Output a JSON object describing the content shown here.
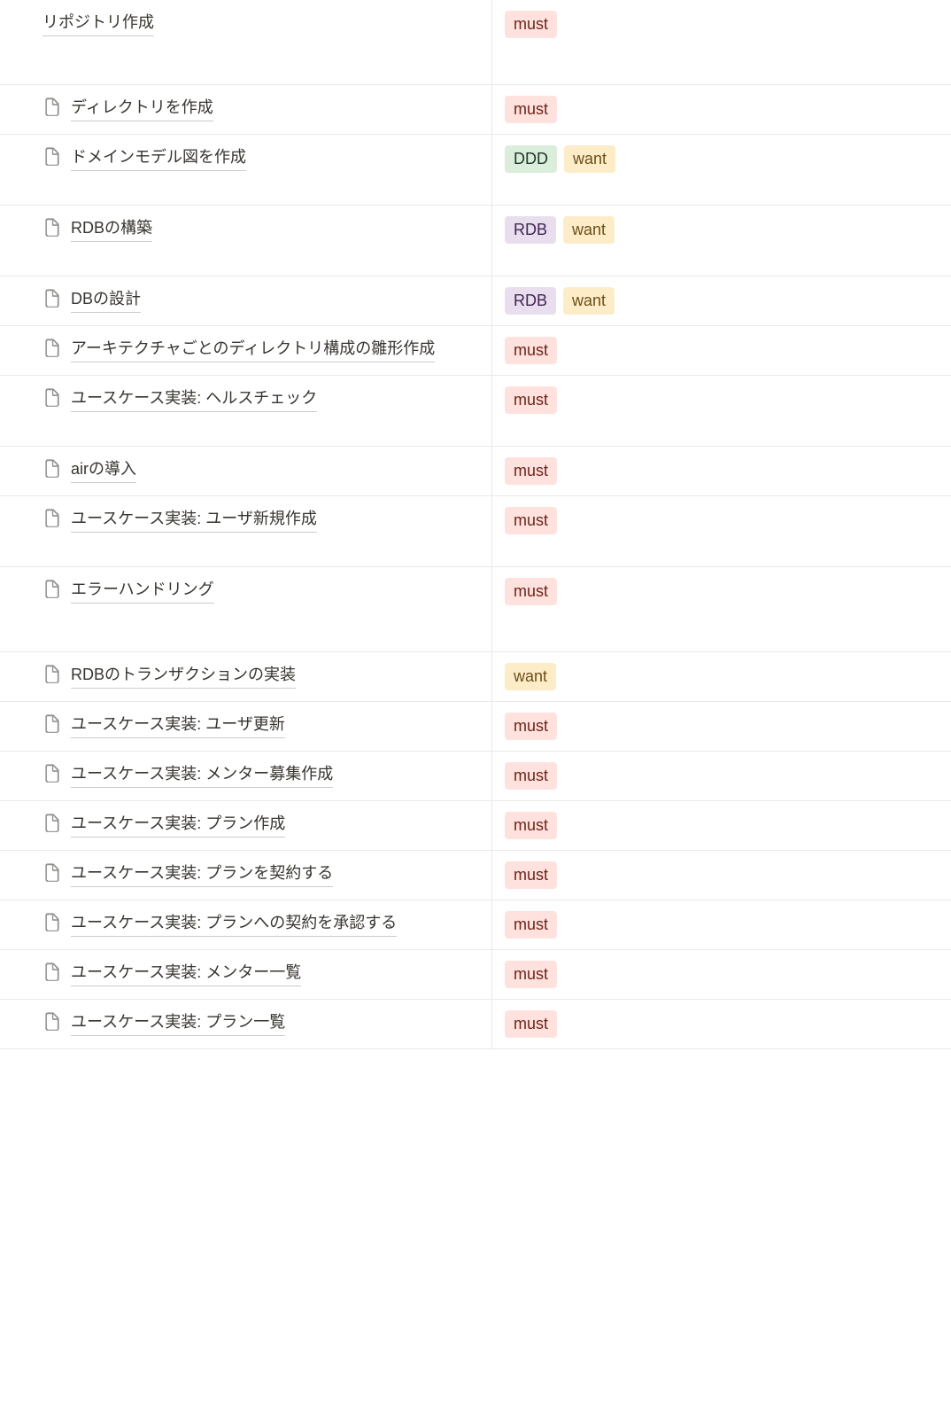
{
  "tags": {
    "must": "must",
    "want": "want",
    "ddd": "DDD",
    "rdb": "RDB"
  },
  "rows": [
    {
      "title": "リポジトリ作成",
      "icon": false,
      "tags": [
        "must"
      ],
      "height": "tall"
    },
    {
      "title": "ディレクトリを作成",
      "icon": true,
      "tags": [
        "must"
      ],
      "height": ""
    },
    {
      "title": "ドメインモデル図を作成",
      "icon": true,
      "tags": [
        "ddd",
        "want"
      ],
      "height": "med"
    },
    {
      "title": "RDBの構築",
      "icon": true,
      "tags": [
        "rdb",
        "want"
      ],
      "height": "med"
    },
    {
      "title": "DBの設計",
      "icon": true,
      "tags": [
        "rdb",
        "want"
      ],
      "height": ""
    },
    {
      "title": "アーキテクチャごとのディレクトリ構成の雛形作成",
      "icon": true,
      "tags": [
        "must"
      ],
      "height": ""
    },
    {
      "title": "ユースケース実装: ヘルスチェック",
      "icon": true,
      "tags": [
        "must"
      ],
      "height": "med"
    },
    {
      "title": "airの導入",
      "icon": true,
      "tags": [
        "must"
      ],
      "height": ""
    },
    {
      "title": "ユースケース実装: ユーザ新規作成",
      "icon": true,
      "tags": [
        "must"
      ],
      "height": "med"
    },
    {
      "title": "エラーハンドリング",
      "icon": true,
      "tags": [
        "must"
      ],
      "height": "tall"
    },
    {
      "title": "RDBのトランザクションの実装",
      "icon": true,
      "tags": [
        "want"
      ],
      "height": ""
    },
    {
      "title": "ユースケース実装: ユーザ更新",
      "icon": true,
      "tags": [
        "must"
      ],
      "height": ""
    },
    {
      "title": "ユースケース実装: メンター募集作成",
      "icon": true,
      "tags": [
        "must"
      ],
      "height": ""
    },
    {
      "title": "ユースケース実装: プラン作成",
      "icon": true,
      "tags": [
        "must"
      ],
      "height": ""
    },
    {
      "title": "ユースケース実装: プランを契約する",
      "icon": true,
      "tags": [
        "must"
      ],
      "height": ""
    },
    {
      "title": "ユースケース実装: プランへの契約を承認する",
      "icon": true,
      "tags": [
        "must"
      ],
      "height": ""
    },
    {
      "title": "ユースケース実装: メンター一覧",
      "icon": true,
      "tags": [
        "must"
      ],
      "height": ""
    },
    {
      "title": "ユースケース実装: プラン一覧",
      "icon": true,
      "tags": [
        "must"
      ],
      "height": ""
    }
  ]
}
